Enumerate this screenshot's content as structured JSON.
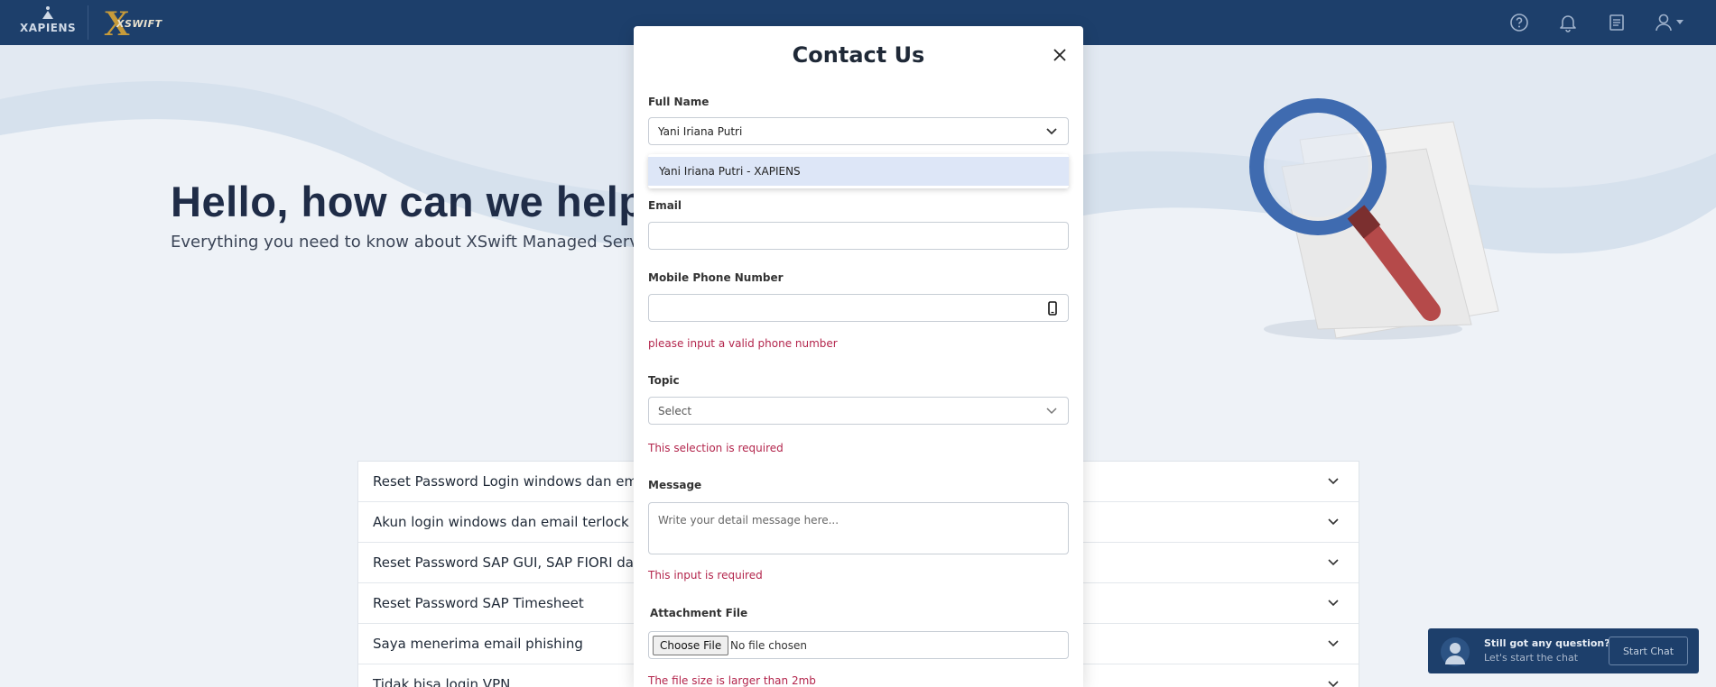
{
  "header": {
    "brand_name": "XAPIENS",
    "product_logo": "XSWIFT",
    "icons": [
      "help-circle-icon",
      "bell-icon",
      "document-list-icon",
      "user-icon",
      "caret-down-icon"
    ]
  },
  "hero": {
    "title": "Hello, how can we help?",
    "subtitle": "Everything you need to know about XSwift Managed Service plat"
  },
  "faq": {
    "items": [
      {
        "label": "Reset Password Login windows dan email"
      },
      {
        "label": "Akun login windows dan email terlock"
      },
      {
        "label": "Reset Password SAP GUI, SAP FIORI dan SA"
      },
      {
        "label": "Reset Password SAP Timesheet"
      },
      {
        "label": "Saya menerima email phishing"
      },
      {
        "label": "Tidak bisa login VPN"
      }
    ]
  },
  "chat_widget": {
    "title": "Still got any question?",
    "subtitle": "Let's start the chat",
    "button_label": "Start Chat"
  },
  "modal": {
    "title": "Contact Us",
    "full_name": {
      "label": "Full Name",
      "value": "Yani Iriana Putri",
      "dropdown_option": "Yani Iriana Putri - XAPIENS"
    },
    "email": {
      "label": "Email",
      "value": ""
    },
    "phone": {
      "label": "Mobile Phone Number",
      "value": "",
      "error": "please input a valid phone number"
    },
    "topic": {
      "label": "Topic",
      "placeholder": "Select",
      "error": "This selection is required"
    },
    "message": {
      "label": "Message",
      "placeholder": "Write your detail message here...",
      "error": "This input is required"
    },
    "attachment": {
      "label": "Attachment File",
      "choose_label": "Choose File",
      "no_file_label": "No file chosen",
      "error": "The file size is larger than 2mb"
    }
  },
  "colors": {
    "navbar": "#1d3f6b",
    "error": "#b3254c",
    "dropdown_highlight": "#dde6f7"
  }
}
